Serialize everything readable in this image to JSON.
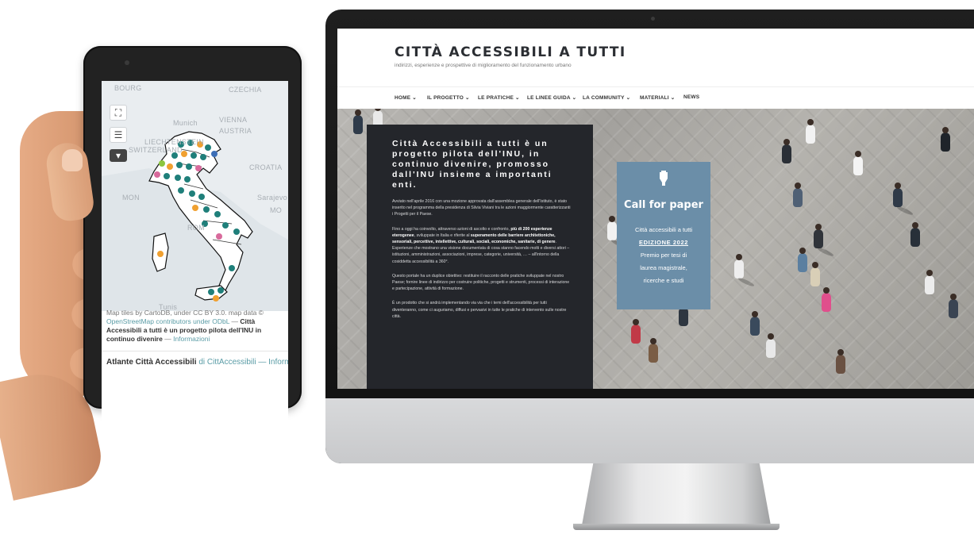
{
  "tablet": {
    "map_labels": {
      "region_1": "BOURG",
      "region_2": "CZECHIA",
      "region_3": "Munich",
      "region_4": "VIENNA",
      "region_5": "AUSTRIA",
      "region_6": "LIECHTENSTEIN",
      "region_7": "SWITZERLAND",
      "region_8": "CROATIA",
      "region_9": "Sarajevo",
      "region_10": "MON",
      "region_11": "MO",
      "region_12": "ROM",
      "region_13": "Tunis"
    },
    "controls": {
      "fullscreen_icon": "fullscreen-icon",
      "layers_icon": "layers-icon",
      "dropdown_icon": "dropdown-icon"
    },
    "attribution": {
      "prefix": "Map tiles by CartoDB, under CC BY 3.0. map data ©",
      "link1": "OpenStreetMap contributors under ODbL",
      "sep": " — ",
      "title": "Città Accessibili a tutti è un progetto pilota dell'INU in continuo divenire",
      "sep2": " — ",
      "link2": "Informazioni"
    },
    "atlante": {
      "title": "Atlante Città Accessibili",
      "by": " di CittAccessibili",
      "sep": " — ",
      "info": "Informazioni"
    },
    "marker_colors": {
      "teal": "#1f7f7a",
      "orange": "#f0a030",
      "pink": "#d86a9c",
      "green": "#8cc63e",
      "blue": "#3d6fb6"
    }
  },
  "site": {
    "title": "CITTÀ ACCESSIBILI A TUTTI",
    "subtitle": "indirizzi, esperienze e prospettive di miglioramento del funzionamento urbano",
    "nav": [
      "HOME ⌄",
      "IL PROGETTO ⌄",
      "LE PRATICHE ⌄",
      "LE LINEE GUIDA ⌄",
      "LA COMMUNITY ⌄",
      "MATERIALI ⌄",
      "NEWS"
    ],
    "panel": {
      "heading": "Città Accessibili a tutti è un progetto pilota dell'INU, in continuo divenire, promosso dall'INU insieme a importanti enti.",
      "p1": "Avviato nell'aprile 2016 con una mozione approvata dall'assemblea generale dell'Istituto, è stato inserito nel programma della presidenza di Silvia Viviani tra le azioni maggiormente caratterizzanti i Progetti per il Paese.",
      "p2_a": "Fino a oggi ha coinvolto, attraverso azioni di ascolto e confronto, ",
      "p2_b": "più di 200 esperienze eterogenee",
      "p2_c": ", sviluppate in Italia e riferite al ",
      "p2_d": "superamento delle barriere architettoniche, sensoriali, percettive, intellettive, culturali, sociali, economiche, sanitarie, di genere",
      "p2_e": ". Esperienze che mostrano una visione documentata di cosa stanno facendo molti e diversi attori – istituzioni, amministrazioni, associazioni, imprese, categorie, università, … – all'intorno della cosiddetta accessibilità a 360°.",
      "p3": "Questo portale ha un duplice obiettivo: restituire il racconto delle pratiche sviluppate nel nostro Paese; fornire linee di indirizzo per costruire politiche, progetti e strumenti, processi di interazione e partecipazione, attività di formazione.",
      "p4": "È un prodotto che si andrà implementando via via che i temi dell'accessibilità per tutti diventeranno, come ci auguriamo, diffusi e pervasivi in tutte le pratiche di intervento sulle nostre città."
    },
    "cfp": {
      "icon": "hand-pointer-icon",
      "title": "Call for paper",
      "line1": "Città accessibili a tutti",
      "edition": "EDIZIONE 2022",
      "line2": "Premio per tesi di",
      "line3": "laurea magistrale,",
      "line4": "ricerche e studi",
      "bg_color": "#6b8ea8"
    },
    "panel_color": "#24262b"
  }
}
